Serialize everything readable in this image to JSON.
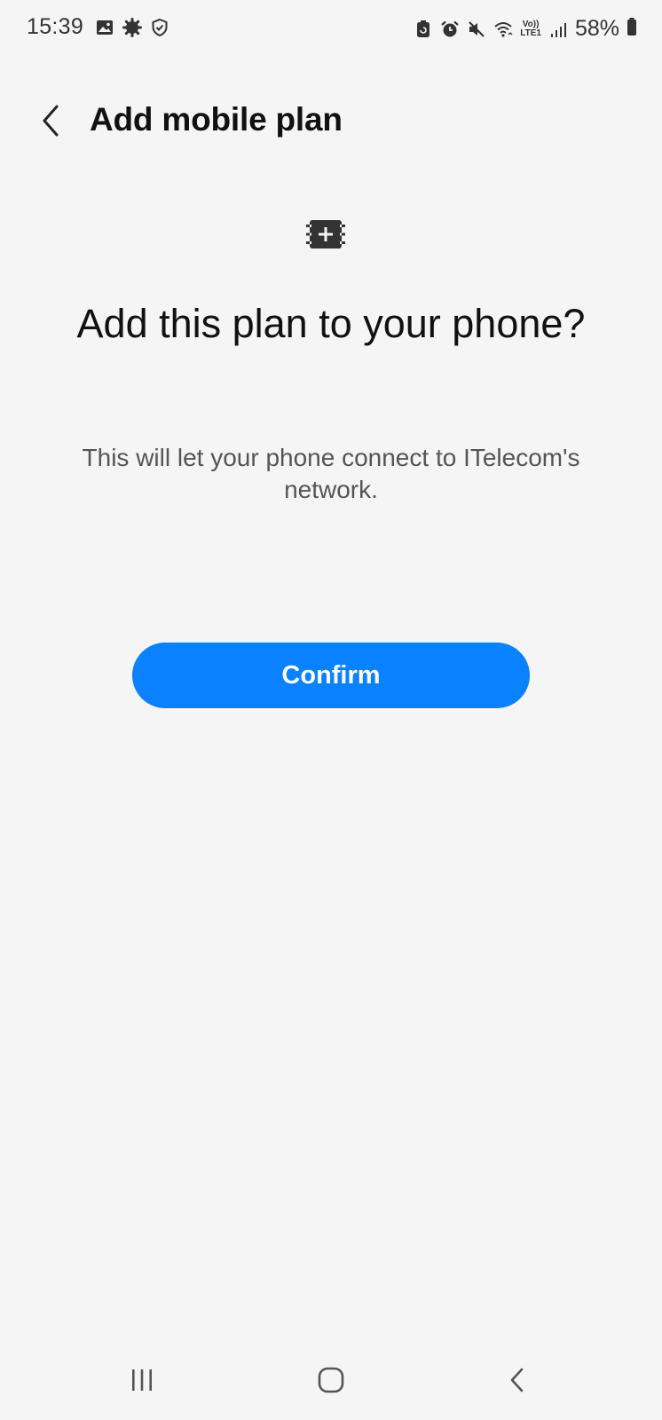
{
  "status_bar": {
    "time": "15:39",
    "battery_percent": "58%",
    "volte_line1": "Vo))",
    "volte_line2": "LTE1",
    "left_icons": [
      "gallery-icon",
      "settings-gear-icon",
      "shield-check-icon"
    ],
    "right_icons": [
      "battery-saver-icon",
      "alarm-icon",
      "mute-icon",
      "wifi-icon",
      "volte-icon",
      "signal-icon",
      "battery-icon"
    ]
  },
  "header": {
    "title": "Add mobile plan",
    "back_icon": "chevron-left-icon"
  },
  "main": {
    "icon": "esim-add-icon",
    "title": "Add this plan to your phone?",
    "description": "This will let your phone connect to ITelecom's network.",
    "confirm_label": "Confirm"
  },
  "colors": {
    "background": "#f5f5f5",
    "accent": "#0a81ff",
    "text_primary": "#111111",
    "text_secondary": "#555555"
  },
  "nav_bar": {
    "recents_icon": "recents-icon",
    "home_icon": "home-icon",
    "back_icon": "back-icon"
  }
}
